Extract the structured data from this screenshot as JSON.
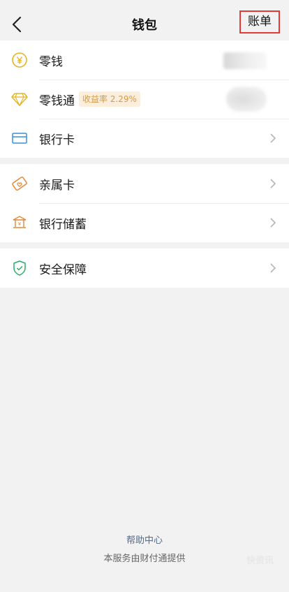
{
  "header": {
    "title": "钱包",
    "bill_label": "账单"
  },
  "wallet_section": {
    "items": [
      {
        "label": "零钱",
        "icon": "yen-coin-icon"
      },
      {
        "label": "零钱通",
        "icon": "diamond-icon",
        "badge": "收益率 2.29%"
      },
      {
        "label": "银行卡",
        "icon": "bank-card-icon"
      }
    ]
  },
  "family_section": {
    "items": [
      {
        "label": "亲属卡",
        "icon": "family-card-icon"
      },
      {
        "label": "银行储蓄",
        "icon": "bank-building-icon"
      }
    ]
  },
  "security_section": {
    "items": [
      {
        "label": "安全保障",
        "icon": "shield-check-icon"
      }
    ]
  },
  "footer": {
    "help_link": "帮助中心",
    "provider_note": "本服务由财付通提供",
    "watermark": "快资讯"
  },
  "colors": {
    "bill_highlight_border": "#e53935",
    "badge_bg": "#fbeedd",
    "badge_text": "#d49a4a",
    "yellow_icon": "#e6b422",
    "blue_icon": "#3a8fd8",
    "orange_icon": "#e0893a",
    "green_icon": "#2aae67"
  }
}
